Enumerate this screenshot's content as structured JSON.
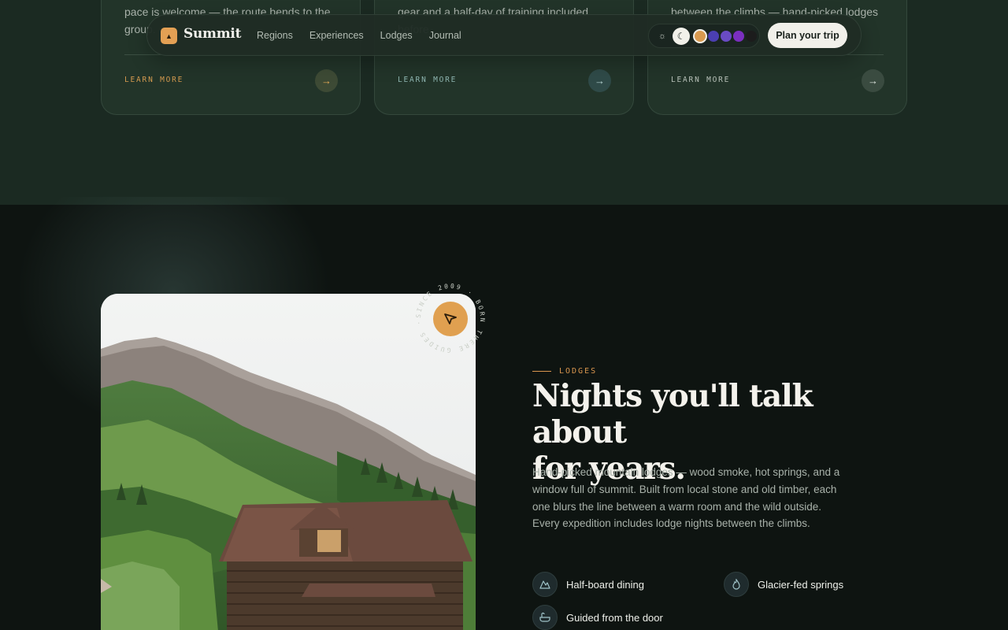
{
  "cards": [
    {
      "text": "pace is welcome — the route bends to the group.",
      "cta": "LEARN MORE",
      "arrow": "arrow-right-icon"
    },
    {
      "text": "gear and a half-day of training included before",
      "cta": "LEARN MORE",
      "arrow": "arrow-right-icon"
    },
    {
      "text": "between the climbs — hand-picked lodges that",
      "cta": "LEARN MORE",
      "arrow": "arrow-right-icon"
    }
  ],
  "nav": {
    "brand": "Summit",
    "brand_icon": "mountain-icon",
    "links": [
      "Regions",
      "Experiences",
      "Lodges",
      "Journal"
    ],
    "theme": {
      "light_icon": "sun-icon",
      "dark_icon": "moon-icon",
      "swatches": [
        "#d99a4f",
        "#4b3fb1",
        "#6a4bc4",
        "#7b2fbf",
        "#1c1c1c"
      ]
    },
    "cta": "Plan your trip"
  },
  "hero": {
    "badge_ring_text": "SINCE 2009 · BORN THERE GUIDES · ",
    "badge_icon": "cursor-icon",
    "eyebrow": "LODGES",
    "headline_line1": "Nights you'll talk about",
    "headline_line2": "for years.",
    "body": "Hand-picked mountain lodges — wood smoke, hot springs, and a window full of summit. Built from local stone and old timber, each one blurs the line between a warm room and the wild outside. Every expedition includes lodge nights between the climbs.",
    "features": [
      {
        "label": "Half-board dining",
        "icon": "mountain-icon"
      },
      {
        "label": "Glacier-fed springs",
        "icon": "flame-icon"
      },
      {
        "label": "Guided from the door",
        "icon": "bath-icon"
      }
    ]
  },
  "colors": {
    "accent": "#e0a050",
    "background": "#0e1411",
    "band": "#1b2a22"
  }
}
